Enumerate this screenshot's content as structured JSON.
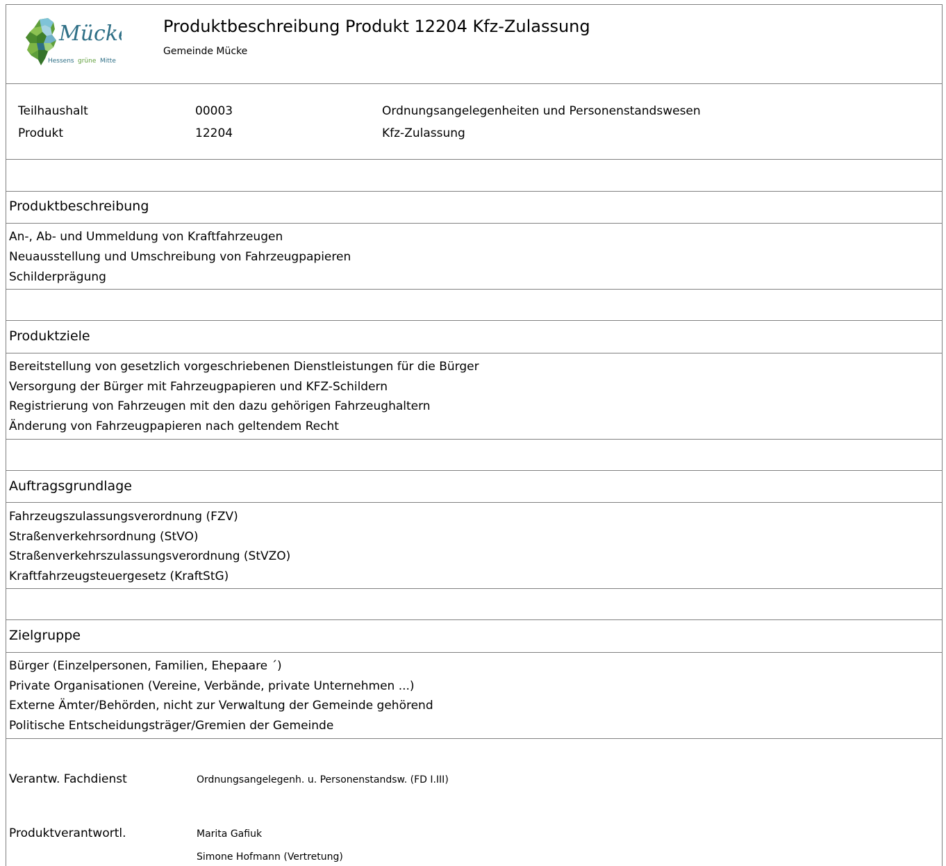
{
  "header": {
    "logo_text": "Mücke",
    "logo_tagline_1": "Hessens",
    "logo_tagline_2": "grüne",
    "logo_tagline_3": "Mitte",
    "title": "Produktbeschreibung Produkt 12204 Kfz-Zulassung",
    "subtitle": "Gemeinde Mücke"
  },
  "info": {
    "rows": [
      {
        "label": "Teilhaushalt",
        "code": "00003",
        "name": "Ordnungsangelegenheiten und Personenstandswesen"
      },
      {
        "label": "Produkt",
        "code": "12204",
        "name": "Kfz-Zulassung"
      }
    ]
  },
  "sections": [
    {
      "heading": "Produktbeschreibung",
      "lines": [
        "An-, Ab- und Ummeldung von Kraftfahrzeugen",
        "Neuausstellung und Umschreibung von Fahrzeugpapieren",
        "Schilderprägung"
      ]
    },
    {
      "heading": "Produktziele",
      "lines": [
        "Bereitstellung von gesetzlich vorgeschriebenen Dienstleistungen für die Bürger",
        "Versorgung der Bürger mit Fahrzeugpapieren und KFZ-Schildern",
        "Registrierung von Fahrzeugen mit den dazu gehörigen Fahrzeughaltern",
        "Änderung von Fahrzeugpapieren nach geltendem Recht"
      ]
    },
    {
      "heading": "Auftragsgrundlage",
      "lines": [
        "Fahrzeugszulassungsverordnung (FZV)",
        "Straßenverkehrsordnung (StVO)",
        "Straßenverkehrszulassungsverordnung (StVZO)",
        "Kraftfahrzeugsteuergesetz (KraftStG)"
      ]
    },
    {
      "heading": "Zielgruppe",
      "lines": [
        "Bürger (Einzelpersonen, Familien, Ehepaare ´)",
        "Private Organisationen (Vereine, Verbände, private Unternehmen ...)",
        "Externe Ämter/Behörden, nicht zur Verwaltung der Gemeinde gehörend",
        "Politische Entscheidungsträger/Gremien der Gemeinde"
      ]
    }
  ],
  "footer": {
    "fachdienst_label": "Verantw. Fachdienst",
    "fachdienst_value": "Ordnungsangelegenh. u. Personenstandsw. (FD I.III)",
    "verantwortlich_label": "Produktverantwortl.",
    "verantwortlich_values": [
      "Marita Gafiuk",
      "Simone Hofmann (Vertretung)"
    ]
  },
  "colors": {
    "logo_green": "#5e9e3a",
    "logo_teal": "#2e6f86",
    "logo_light_blue": "#7fc3d8",
    "border": "#7f7f7f"
  }
}
